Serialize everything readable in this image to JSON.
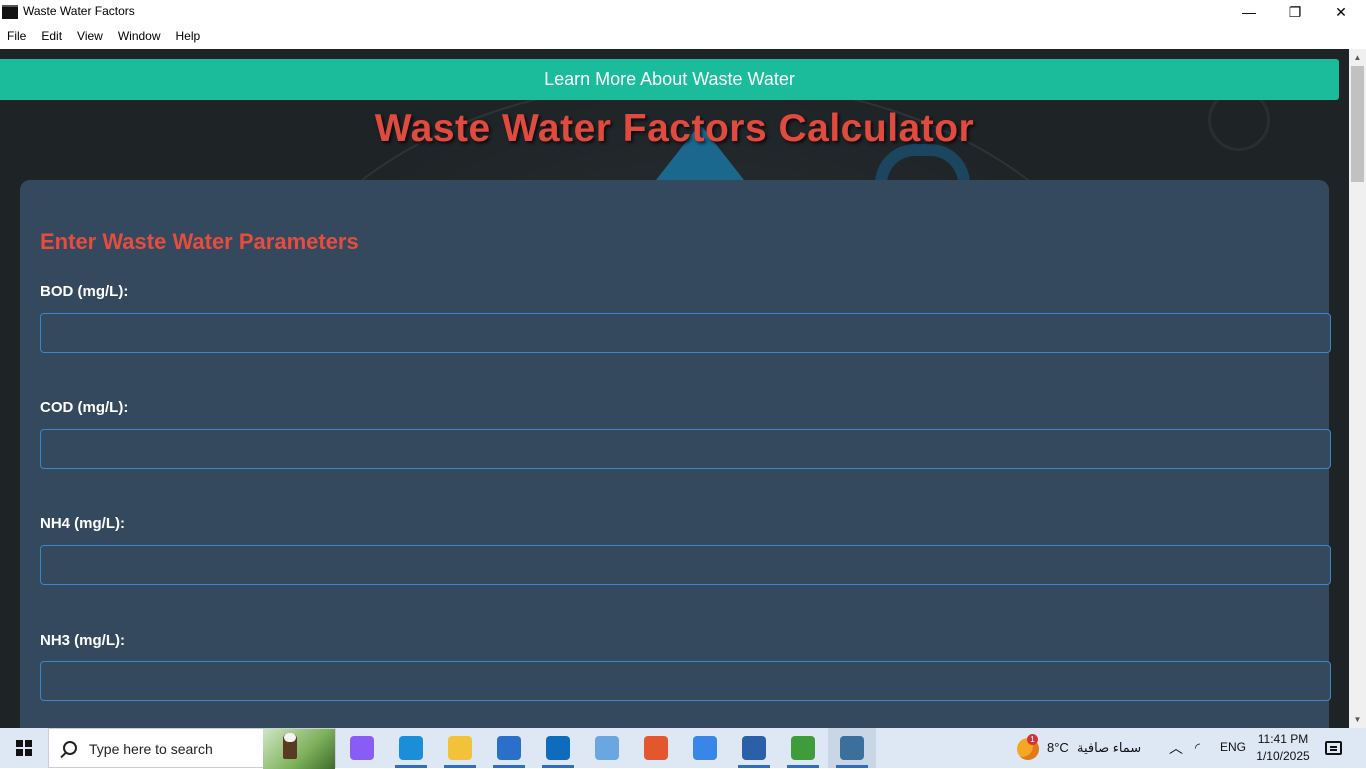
{
  "window": {
    "title": "Waste Water Factors",
    "minimize_glyph": "—",
    "maximize_glyph": "❐",
    "close_glyph": "✕"
  },
  "menu": [
    "File",
    "Edit",
    "View",
    "Window",
    "Help"
  ],
  "page": {
    "learn_more_label": "Learn More About Waste Water",
    "title": "Waste Water Factors Calculator",
    "form_heading": "Enter Waste Water Parameters",
    "fields": [
      {
        "label": "BOD (mg/L):",
        "value": ""
      },
      {
        "label": "COD (mg/L):",
        "value": ""
      },
      {
        "label": "NH4 (mg/L):",
        "value": ""
      },
      {
        "label": "NH3 (mg/L):",
        "value": ""
      }
    ]
  },
  "taskbar": {
    "search_placeholder": "Type here to search",
    "apps": [
      {
        "name": "copilot-icon",
        "color": "#8a5cf6"
      },
      {
        "name": "edge-icon",
        "color": "#1a8fd8",
        "active": true
      },
      {
        "name": "file-explorer-icon",
        "color": "#f2c23a",
        "active": true
      },
      {
        "name": "microsoft-store-icon",
        "color": "#2a6fc9",
        "active": true
      },
      {
        "name": "outlook-icon",
        "color": "#0f6cbd",
        "active": true
      },
      {
        "name": "remote-desktop-icon",
        "color": "#6aa6e0"
      },
      {
        "name": "matlab-icon",
        "color": "#e4572e"
      },
      {
        "name": "app-a-icon",
        "color": "#3a86e8"
      },
      {
        "name": "powershell-icon",
        "color": "#2b5fa8",
        "active": true
      },
      {
        "name": "chart-app-icon",
        "color": "#3f9c3a",
        "active": true
      },
      {
        "name": "waste-water-app-icon",
        "color": "#3b6f9c",
        "active": true,
        "current": true
      }
    ],
    "weather_badge": "1",
    "temperature": "8°C",
    "weather_text": "سماء صافية",
    "language": "ENG",
    "time": "11:41 PM",
    "date": "1/10/2025"
  },
  "colors": {
    "accent_button": "#1abc9c",
    "title_red": "#e04a3f",
    "card_bg": "#34495e",
    "input_border": "#3a86c8"
  }
}
